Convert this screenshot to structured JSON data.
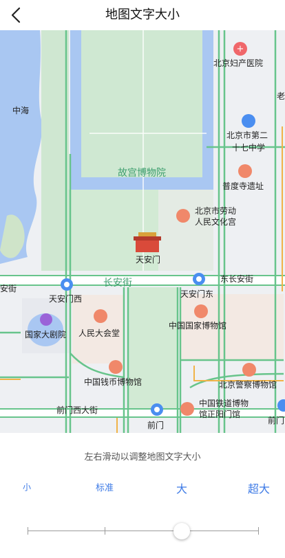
{
  "header": {
    "title": "地图文字大小"
  },
  "map": {
    "labels": {
      "zhonghai": "中海",
      "fuchan": "北京妇产医院",
      "lao": "老",
      "school_1": "北京市第二",
      "school_2": "十七中学",
      "gugong": "故宫博物院",
      "pudu": "普度寺遗址",
      "laodong_1": "北京市劳动",
      "laodong_2": "人民文化宫",
      "tiananmen": "天安门",
      "anjie": "安街",
      "changan": "长安街",
      "dongchangan": "东长安街",
      "tam_xi": "天安门西",
      "tam_dong": "天安门东",
      "juyuan": "国家大剧院",
      "renda": "人民大会堂",
      "guobo": "中国国家博物馆",
      "qianbi": "中国钱币博物馆",
      "jingcha": "北京警察博物馆",
      "tiedao_1": "中国铁道博物",
      "tiedao_2": "馆正阳门馆",
      "qianmenxi": "前门西大街",
      "qianmen": "前门",
      "qianmen2": "前门"
    }
  },
  "panel": {
    "hint": "左右滑动以调整地图文字大小",
    "sizes": [
      "小",
      "标准",
      "大",
      "超大"
    ],
    "selected_index": 2
  }
}
